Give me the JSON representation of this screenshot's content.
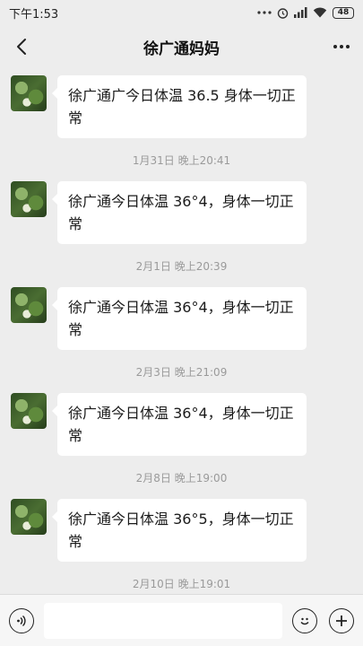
{
  "status_bar": {
    "time": "下午1:53",
    "battery": "48"
  },
  "header": {
    "title": "徐广通妈妈"
  },
  "messages": [
    {
      "text": "徐广通广今日体温 36.5 身体一切正常"
    },
    {
      "timestamp": "1月31日 晚上20:41",
      "text": "徐广通今日体温 36°4，身体一切正常"
    },
    {
      "timestamp": "2月1日 晚上20:39",
      "text": "徐广通今日体温 36°4，身体一切正常"
    },
    {
      "timestamp": "2月3日 晚上21:09",
      "text": "徐广通今日体温 36°4，身体一切正常"
    },
    {
      "timestamp": "2月8日 晚上19:00",
      "text": "徐广通今日体温 36°5，身体一切正常"
    },
    {
      "timestamp": "2月10日 晚上19:01"
    }
  ],
  "input_bar": {
    "value": ""
  },
  "icons": {
    "back": "chevron-left-icon",
    "more": "more-dots-icon",
    "voice": "voice-icon",
    "emoji": "emoji-icon",
    "plus": "plus-icon",
    "signal": "signal-icon",
    "wifi": "wifi-icon",
    "alarm": "alarm-icon"
  }
}
